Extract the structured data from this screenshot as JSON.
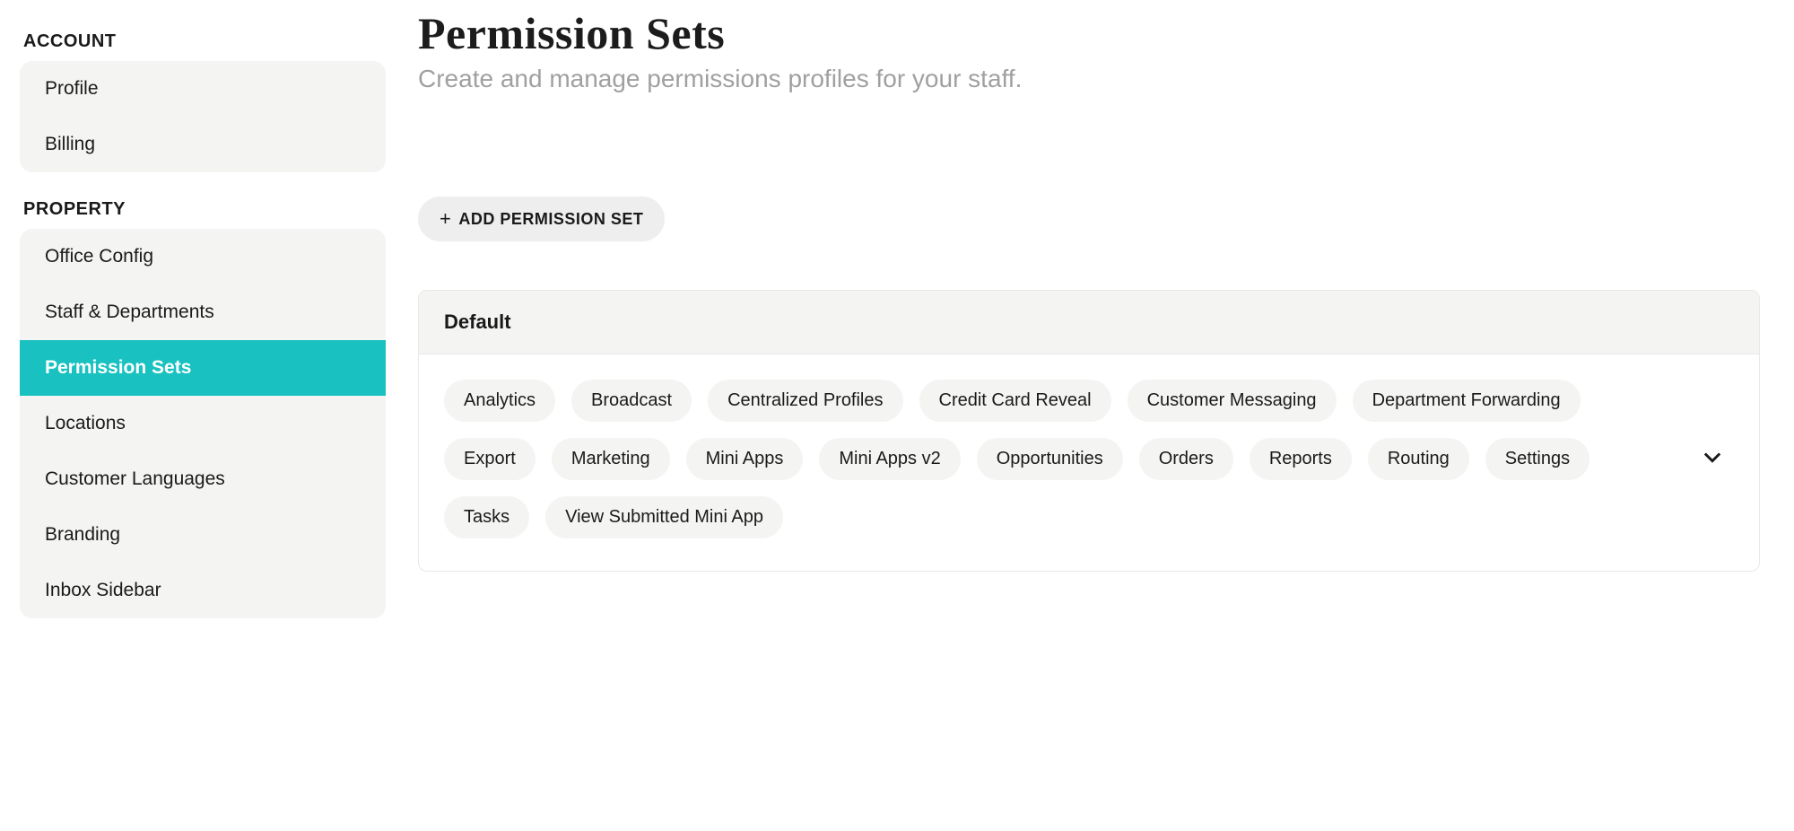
{
  "sidebar": {
    "sections": [
      {
        "label": "ACCOUNT",
        "items": [
          {
            "label": "Profile",
            "active": false
          },
          {
            "label": "Billing",
            "active": false
          }
        ]
      },
      {
        "label": "PROPERTY",
        "items": [
          {
            "label": "Office Config",
            "active": false
          },
          {
            "label": "Staff & Departments",
            "active": false
          },
          {
            "label": "Permission Sets",
            "active": true
          },
          {
            "label": "Locations",
            "active": false
          },
          {
            "label": "Customer Languages",
            "active": false
          },
          {
            "label": "Branding",
            "active": false
          },
          {
            "label": "Inbox Sidebar",
            "active": false
          }
        ]
      }
    ]
  },
  "page": {
    "title": "Permission Sets",
    "subtitle": "Create and manage permissions profiles for your staff.",
    "addButtonLabel": "ADD PERMISSION SET"
  },
  "permissionSets": [
    {
      "name": "Default",
      "permissions": [
        "Analytics",
        "Broadcast",
        "Centralized Profiles",
        "Credit Card Reveal",
        "Customer Messaging",
        "Department Forwarding",
        "Export",
        "Marketing",
        "Mini Apps",
        "Mini Apps v2",
        "Opportunities",
        "Orders",
        "Reports",
        "Routing",
        "Settings",
        "Tasks",
        "View Submitted Mini App"
      ]
    }
  ]
}
